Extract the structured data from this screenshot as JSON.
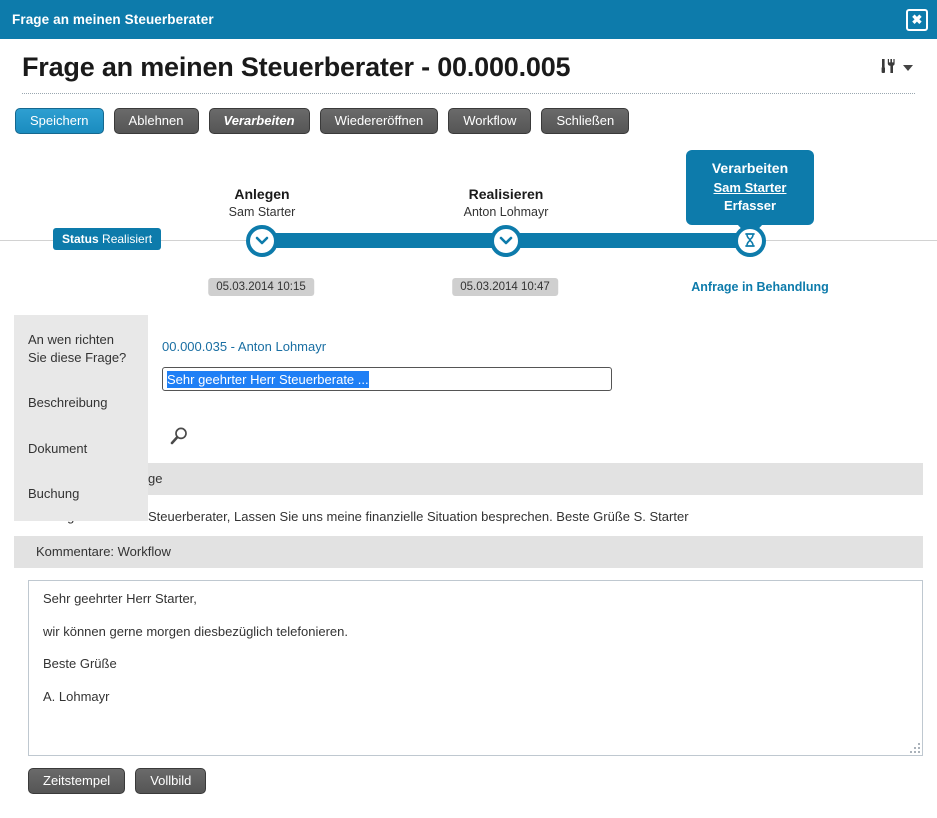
{
  "window": {
    "title": "Frage an meinen Steuerberater",
    "close_icon": "close-icon",
    "close_glyph": "✖"
  },
  "header": {
    "page_title": "Frage an meinen Steuerberater - 00.000.005",
    "tools_icon": "tools-icon",
    "caret_icon": "chevron-down-icon"
  },
  "toolbar": {
    "buttons": [
      {
        "label": "Speichern",
        "state": "primary"
      },
      {
        "label": "Ablehnen",
        "state": "default"
      },
      {
        "label": "Verarbeiten",
        "state": "bold-italic"
      },
      {
        "label": "Wiedereröffnen",
        "state": "default"
      },
      {
        "label": "Workflow",
        "state": "default"
      },
      {
        "label": "Schließen",
        "state": "default"
      }
    ]
  },
  "timeline": {
    "status_badge": {
      "prefix": "Status",
      "value": "Realisiert"
    },
    "steps": [
      {
        "title": "Anlegen",
        "person": "Sam Starter",
        "timestamp": "05.03.2014 10:15",
        "icon": "check-circle-icon",
        "glyph": "✓"
      },
      {
        "title": "Realisieren",
        "person": "Anton Lohmayr",
        "timestamp": "05.03.2014 10:47",
        "icon": "check-circle-icon",
        "glyph": "✓"
      },
      {
        "title": "Verarbeiten",
        "person": "Sam Starter",
        "role": "Erfasser",
        "state_link": "Anfrage in Behandlung",
        "icon": "hourglass-icon",
        "glyph": "⧗"
      }
    ]
  },
  "form": {
    "labels": [
      "An wen richten\nSie diese Frage?",
      "Beschreibung",
      "Dokument",
      "Buchung"
    ],
    "label_recipient_line1": "An wen richten",
    "label_recipient_line2": "Sie diese Frage?",
    "label_description": "Beschreibung",
    "label_document": "Dokument",
    "label_booking": "Buchung",
    "recipient_value": "00.000.035 - Anton Lohmayr",
    "description_value": "Sehr geehrter Herr Steuerberate ...",
    "search_icon": "search-icon"
  },
  "comments_request": {
    "heading": "Kommentare: Anfrage",
    "body": "Sehr geehrter Herr Steuerberater, Lassen Sie uns meine finanzielle Situation besprechen. Beste Grüße S. Starter"
  },
  "comments_workflow": {
    "heading": "Kommentare: Workflow",
    "lines": [
      "Sehr geehrter Herr Starter,",
      "wir können gerne morgen diesbezüglich telefonieren.",
      "Beste Grüße",
      "A. Lohmayr"
    ],
    "line_1": "Sehr geehrter Herr Starter,",
    "line_2": "wir können gerne morgen diesbezüglich telefonieren.",
    "line_3": "Beste Grüße",
    "line_4": "A. Lohmayr"
  },
  "footer": {
    "timestamp_button": "Zeitstempel",
    "fullscreen_button": "Vollbild"
  },
  "colors": {
    "accent_blue": "#0d7bab",
    "selection_blue": "#1f7ff5",
    "button_gray": "#5e5e5e",
    "panel_gray": "#e8e8e8",
    "section_gray": "#e2e2e2",
    "badge_gray": "#cfcfcf",
    "link_blue": "#1a6fa3"
  }
}
